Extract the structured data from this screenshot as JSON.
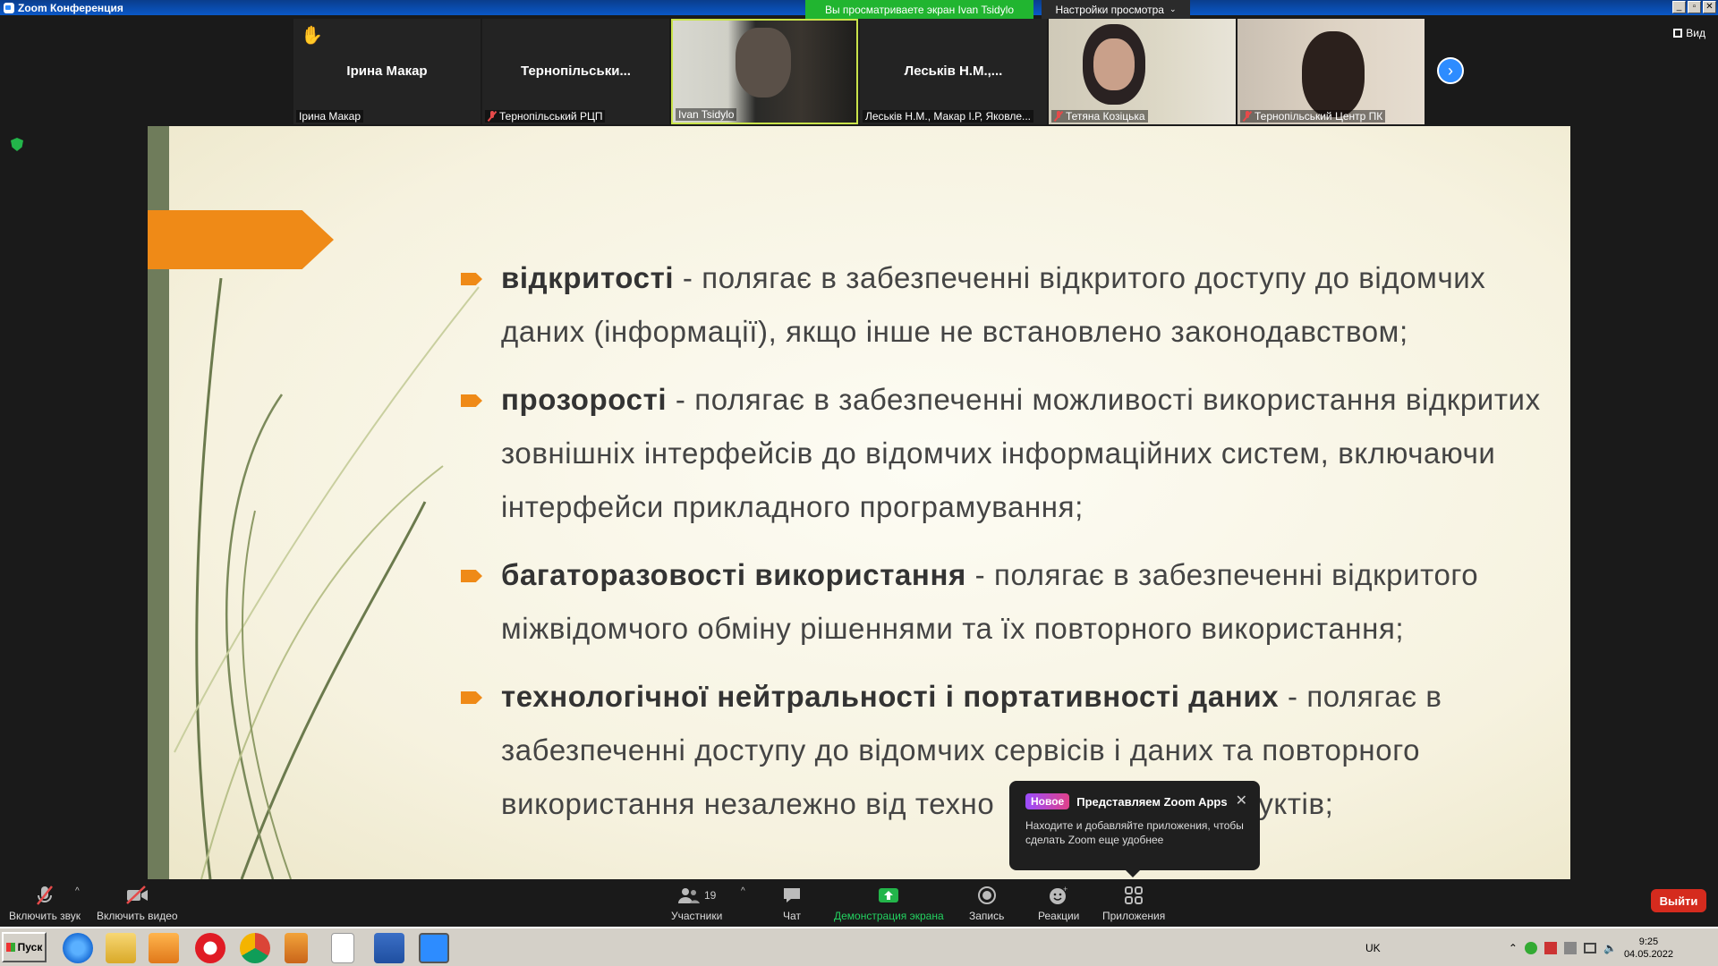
{
  "window": {
    "title": "Zoom Конференция",
    "share_banner": "Вы просматриваете экран Ivan Tsidylo",
    "view_settings": "Настройки просмотра",
    "view_button": "Вид"
  },
  "participants_strip": [
    {
      "center_name": "Ірина Макар",
      "label": "Ірина Макар",
      "muted": false,
      "hand_raised": true
    },
    {
      "center_name": "Тернопільськи...",
      "label": "Тернопільський РЦП",
      "muted": true
    },
    {
      "center_name": "",
      "label": "Ivan Tsidylo",
      "muted": false,
      "video": true
    },
    {
      "center_name": "Леськів Н.М.,...",
      "label": "Леськів Н.М., Макар І.Р, Яковле...",
      "muted": false
    },
    {
      "center_name": "",
      "label": "Тетяна Козіцька",
      "muted": true,
      "video": true
    },
    {
      "center_name": "",
      "label": "Тернопільський Центр ПК",
      "muted": true,
      "video": true
    }
  ],
  "slide": {
    "bullets": [
      {
        "term": "відкритості",
        "text": " - полягає в забезпеченні відкритого доступу до відомчих даних (інформації), якщо інше не встановлено законодавством;"
      },
      {
        "term": "прозорості",
        "text": " - полягає в забезпеченні можливості використання відкритих зовнішніх інтерфейсів до відомчих інформаційних систем, включаючи інтерфейси прикладного програмування;"
      },
      {
        "term": "багаторазовості використання",
        "text": " - полягає в забезпеченні відкритого міжвідомчого обміну рішеннями та їх повторного використання;"
      },
      {
        "term": "технологічної нейтральності і портативності даних",
        "text": " - полягає в забезпеченні доступу до відомчих сервісів і даних та повторного використання незалежно від техно"
      },
      {
        "tail": "уктів;"
      }
    ]
  },
  "popup": {
    "badge": "Новое",
    "title": "Представляем Zoom Apps",
    "body": "Находите и добавляйте приложения, чтобы сделать Zoom еще удобнее"
  },
  "toolbar": {
    "audio": "Включить звук",
    "video": "Включить видео",
    "participants": "Участники",
    "participants_count": "19",
    "chat": "Чат",
    "share": "Демонстрация экрана",
    "record": "Запись",
    "reactions": "Реакции",
    "apps": "Приложения",
    "leave": "Выйти"
  },
  "taskbar": {
    "start": "Пуск",
    "lang": "UK",
    "time": "9:25",
    "date": "04.05.2022"
  },
  "colors": {
    "accent_orange": "#ef8a17",
    "slide_bar": "#6f7c5b",
    "share_green": "#21b530",
    "leave_red": "#d52b1e"
  }
}
